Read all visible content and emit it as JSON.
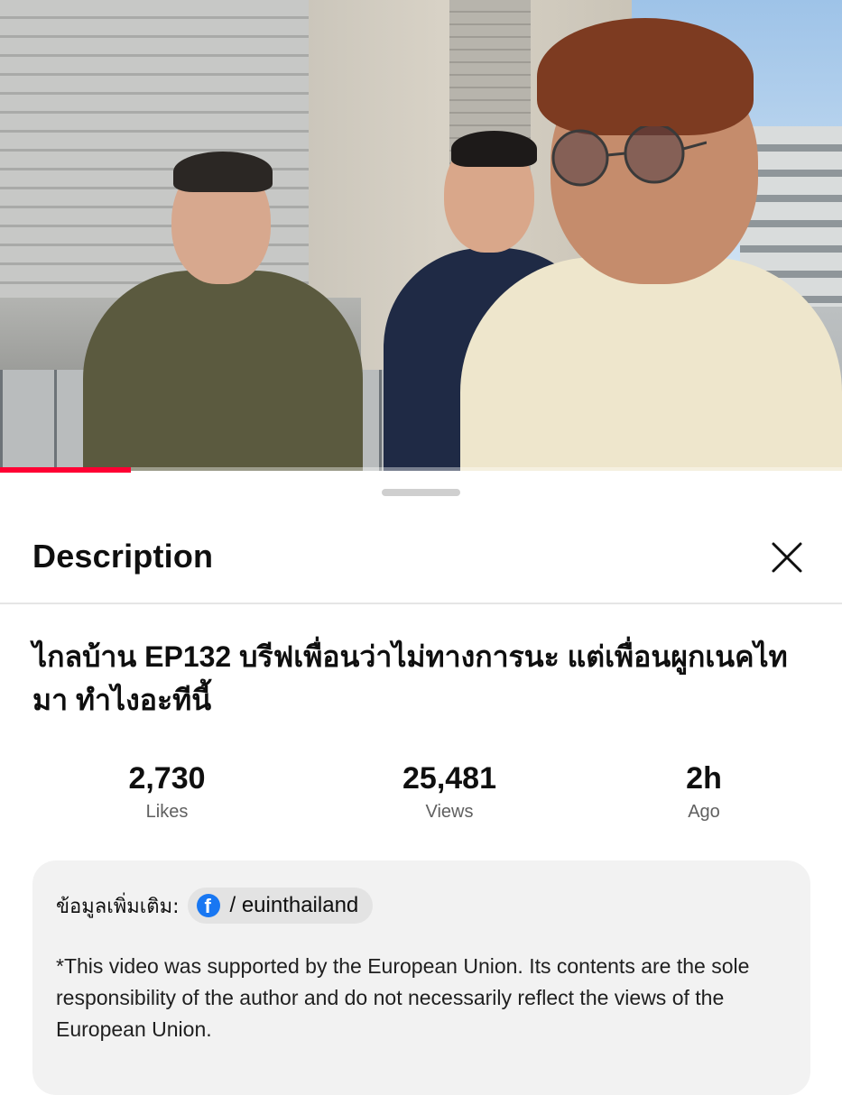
{
  "video": {
    "progress_percent": 15.5
  },
  "sheet": {
    "title": "Description"
  },
  "video_info": {
    "title": "ไกลบ้าน EP132 บรีฟเพื่อนว่าไม่ทางการนะ แต่เพื่อนผูกเนคไทมา ทำไงอะทีนี้",
    "stats": [
      {
        "value": "2,730",
        "label": "Likes"
      },
      {
        "value": "25,481",
        "label": "Views"
      },
      {
        "value": "2h",
        "label": "Ago"
      }
    ]
  },
  "info_box": {
    "more_info_label": "ข้อมูลเพิ่มเติม:",
    "facebook_link": "/ euinthailand",
    "disclaimer": "*This video was supported by the European Union. Its contents are the sole responsibility of the author and do not necessarily reflect the views of the European Union."
  },
  "colors": {
    "progress": "#ff0033",
    "facebook": "#1877f2"
  },
  "icons": [
    "close-icon",
    "facebook-icon"
  ]
}
